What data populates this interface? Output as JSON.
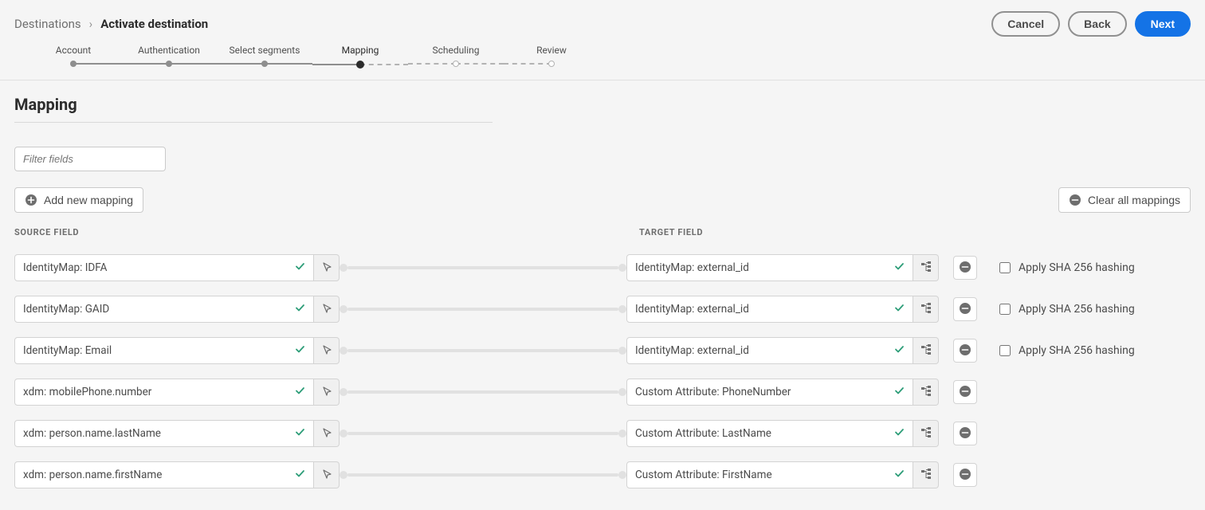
{
  "breadcrumb": {
    "parent": "Destinations",
    "current": "Activate destination"
  },
  "header_buttons": {
    "cancel": "Cancel",
    "back": "Back",
    "next": "Next"
  },
  "steps": {
    "account": "Account",
    "authentication": "Authentication",
    "select_segments": "Select segments",
    "mapping": "Mapping",
    "scheduling": "Scheduling",
    "review": "Review"
  },
  "page_title": "Mapping",
  "filter_placeholder": "Filter fields",
  "toolbar": {
    "add": "Add new mapping",
    "clear": "Clear all mappings"
  },
  "column_headers": {
    "source": "SOURCE FIELD",
    "target": "TARGET FIELD"
  },
  "hash_label": "Apply SHA 256 hashing",
  "mappings": [
    {
      "source": "IdentityMap: IDFA",
      "target": "IdentityMap: external_id",
      "hash_option": true
    },
    {
      "source": "IdentityMap: GAID",
      "target": "IdentityMap: external_id",
      "hash_option": true
    },
    {
      "source": "IdentityMap: Email",
      "target": "IdentityMap: external_id",
      "hash_option": true
    },
    {
      "source": "xdm: mobilePhone.number",
      "target": "Custom Attribute: PhoneNumber",
      "hash_option": false
    },
    {
      "source": "xdm: person.name.lastName",
      "target": "Custom Attribute: LastName",
      "hash_option": false
    },
    {
      "source": "xdm: person.name.firstName",
      "target": "Custom Attribute: FirstName",
      "hash_option": false
    }
  ]
}
